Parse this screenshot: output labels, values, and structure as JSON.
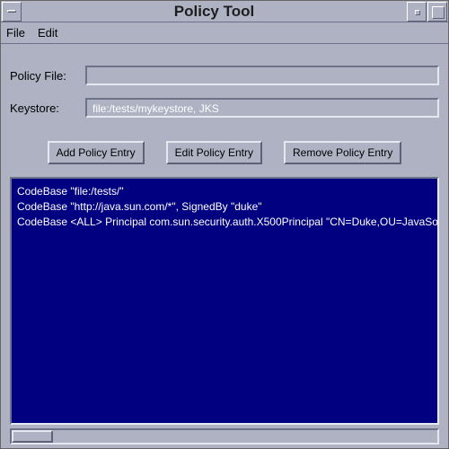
{
  "window": {
    "title": "Policy Tool"
  },
  "menu": {
    "file": "File",
    "edit": "Edit"
  },
  "fields": {
    "policy_label": "Policy File:",
    "policy_value": "",
    "keystore_label": "Keystore:",
    "keystore_value": "file:/tests/mykeystore, JKS"
  },
  "buttons": {
    "add": "Add Policy Entry",
    "edit": "Edit Policy Entry",
    "remove": "Remove Policy Entry"
  },
  "entries": [
    "CodeBase \"file:/tests/\"",
    "CodeBase \"http://java.sun.com/*\", SignedBy \"duke\"",
    "CodeBase <ALL>  Principal com.sun.security.auth.X500Principal \"CN=Duke,OU=JavaSo"
  ]
}
